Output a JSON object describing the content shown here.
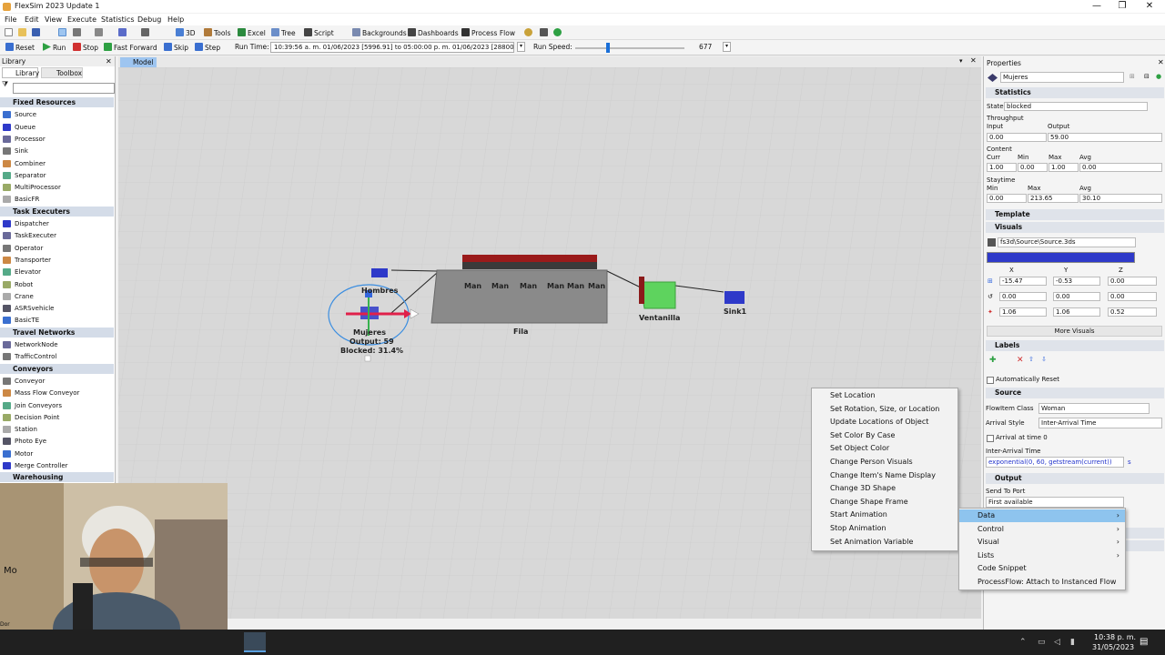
{
  "window": {
    "title": "FlexSim 2023 Update 1",
    "min": "—",
    "max": "❐",
    "close": "✕"
  },
  "menu": [
    "File",
    "Edit",
    "View",
    "Execute",
    "Statistics",
    "Debug",
    "Help"
  ],
  "toolbar": {
    "b3d": "3D",
    "tools": "Tools",
    "excel": "Excel",
    "tree": "Tree",
    "script": "Script",
    "backgrounds": "Backgrounds",
    "dashboards": "Dashboards",
    "process_flow": "Process Flow"
  },
  "runbar": {
    "reset": "Reset",
    "run": "Run",
    "stop": "Stop",
    "fast_forward": "Fast Forward",
    "skip": "Skip",
    "step": "Step",
    "run_time_label": "Run Time:",
    "run_time_value": "10:39:56 a. m.  01/06/2023  [5996.91]   to   05:00:00 p. m.  01/06/2023  [28800",
    "run_speed_label": "Run Speed:",
    "run_speed_value": "677"
  },
  "library": {
    "tabs": [
      "Library",
      "Toolbox"
    ],
    "close": "✕",
    "groups": [
      {
        "name": "Fixed Resources",
        "items": [
          "Source",
          "Queue",
          "Processor",
          "Sink",
          "Combiner",
          "Separator",
          "MultiProcessor",
          "BasicFR"
        ]
      },
      {
        "name": "Task Executers",
        "items": [
          "Dispatcher",
          "TaskExecuter",
          "Operator",
          "Transporter",
          "Elevator",
          "Robot",
          "Crane",
          "ASRSvehicle",
          "BasicTE"
        ]
      },
      {
        "name": "Travel Networks",
        "items": [
          "NetworkNode",
          "TrafficControl"
        ]
      },
      {
        "name": "Conveyors",
        "items": [
          "Conveyor",
          "Mass Flow Conveyor",
          "Join Conveyors",
          "Decision Point",
          "Station",
          "Photo Eye",
          "Motor",
          "Merge Controller"
        ]
      },
      {
        "name": "Warehousing",
        "items": []
      }
    ]
  },
  "model_view": {
    "tab": "Model",
    "labels": {
      "hombres": "Hombres",
      "mujeres": "Mujeres",
      "output": "Output: 59",
      "blocked": "Blocked: 31.4%",
      "fila": "Fila",
      "ventanilla": "Ventanilla",
      "sink": "Sink1",
      "man": [
        "Man",
        "Man",
        "Man",
        "Man",
        "Man",
        "Man"
      ]
    }
  },
  "properties": {
    "title": "Properties",
    "name": "Mujeres",
    "statistics": {
      "header": "Statistics",
      "state_label": "State",
      "state": "blocked",
      "throughput_label": "Throughput",
      "input_label": "Input",
      "output_label": "Output",
      "input": "0.00",
      "output": "59.00",
      "content_label": "Content",
      "curr_label": "Curr",
      "min_label": "Min",
      "max_label": "Max",
      "avg_label": "Avg",
      "curr": "1.00",
      "min": "0.00",
      "max": "1.00",
      "avg": "0.00",
      "staytime_label": "Staytime",
      "st_min": "0.00",
      "st_max": "213.65",
      "st_avg": "30.10"
    },
    "template": "Template",
    "visuals": {
      "header": "Visuals",
      "shape": "fs3d\\Source\\Source.3ds",
      "color": "#2e39c9",
      "x_label": "X",
      "y_label": "Y",
      "z_label": "Z",
      "pos": [
        "-15.47",
        "-0.53",
        "0.00"
      ],
      "rot": [
        "0.00",
        "0.00",
        "0.00"
      ],
      "size": [
        "1.06",
        "1.06",
        "0.52"
      ],
      "more": "More Visuals"
    },
    "labels": {
      "header": "Labels",
      "auto_reset": "Automatically Reset"
    },
    "source": {
      "header": "Source",
      "flowitem_label": "FlowItem Class",
      "flowitem": "Woman",
      "arrival_style_label": "Arrival Style",
      "arrival_style": "Inter-Arrival Time",
      "arrival_at_0": "Arrival at time 0",
      "iat_label": "Inter-Arrival Time",
      "iat": "exponential(0, 60, getstream(current))",
      "iat_unit": "s"
    },
    "output": {
      "header": "Output",
      "send_to_port_label": "Send To Port",
      "send_to_port": "First available"
    }
  },
  "context_menu_main": {
    "items": [
      {
        "label": "Data",
        "submenu": true,
        "selected": true
      },
      {
        "label": "Control",
        "submenu": true
      },
      {
        "label": "Visual",
        "submenu": true
      },
      {
        "label": "Lists",
        "submenu": true
      },
      {
        "label": "Code Snippet",
        "submenu": false
      },
      {
        "label": "ProcessFlow: Attach to Instanced Flow",
        "submenu": false
      }
    ]
  },
  "context_menu_sub": {
    "items": [
      "Set Location",
      "Set Rotation, Size, or Location",
      "Update Locations of Object",
      "Set Color By Case",
      "Set Object Color",
      "Change Person Visuals",
      "Change Item's Name Display",
      "Change 3D Shape",
      "Change Shape Frame",
      "Start Animation",
      "Stop Animation",
      "Set Animation Variable"
    ]
  },
  "taskbar": {
    "time": "10:38 p. m.",
    "date": "31/05/2023"
  },
  "overlay": {
    "left_fragment_1": "Mo",
    "left_fragment_2": "Dor"
  }
}
